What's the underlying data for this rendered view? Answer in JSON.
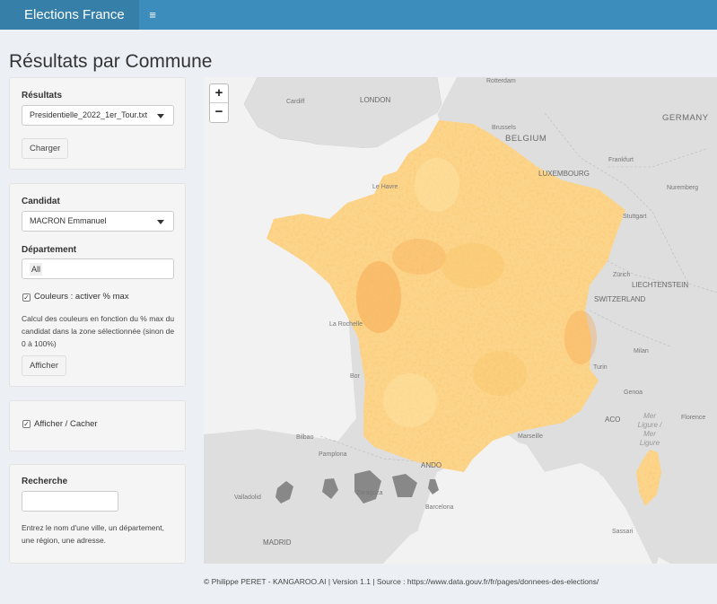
{
  "header": {
    "brand": "Elections France",
    "menu_icon": "hamburger-icon",
    "menu_glyph": "≡"
  },
  "page": {
    "title": "Résultats par Commune"
  },
  "results_panel": {
    "label": "Résultats",
    "file_select": "Presidentielle_2022_1er_Tour.txt",
    "load_button": "Charger"
  },
  "candidate_panel": {
    "candidate_label": "Candidat",
    "candidate_select": "MACRON Emmanuel",
    "department_label": "Département",
    "department_value": "All",
    "colors_checkbox_label": "Couleurs : activer % max",
    "colors_checked": true,
    "help_text": "Calcul des couleurs en fonction du % max du candidat dans la zone sélectionnée (sinon de 0 à 100%)",
    "show_button": "Afficher"
  },
  "toggle_panel": {
    "checkbox_label": "Afficher / Cacher",
    "checked": true
  },
  "search_panel": {
    "label": "Recherche",
    "input_value": "",
    "help_text": "Entrez le nom d'une ville, un département, une région, une adresse."
  },
  "map": {
    "zoom_in": "+",
    "zoom_out": "−",
    "labels": {
      "london": "LONDON",
      "cardiff": "Cardiff",
      "rotterdam": "Rotterdam",
      "brussels": "Brussels",
      "belgium": "BELGIUM",
      "germany": "GERMANY",
      "luxembourg": "LUXEMBOURG",
      "frankfurt": "Frankfurt",
      "le_havre": "Le Havre",
      "nuremberg": "Nuremberg",
      "stuttgart": "Stuttgart",
      "zurich": "Zürich",
      "liechtenstein": "LIECHTENSTEIN",
      "switzerland": "SWITZERLAND",
      "la_rochelle": "La Rochelle",
      "milan": "Milan",
      "turin": "Turin",
      "genoa": "Genoa",
      "bordeaux": "Bor",
      "monaco": "ACO",
      "mer_ligure": "Mer Ligure / Mer Ligure",
      "florence": "Florence",
      "bilbao": "Bilbao",
      "marseille": "Marseille",
      "andorra": "ANDO",
      "pamplona": "Pamplona",
      "valladolid": "Valladolid",
      "zaragoza": "Zaragoza",
      "barcelona": "Barcelona",
      "madrid": "MADRID",
      "sassari": "Sassari"
    },
    "colors": {
      "sea": "#f2f2f2",
      "land": "#dedede",
      "result_light": "#fde3a4",
      "result_mid": "#fbc56a",
      "result_dark": "#f0903a"
    }
  },
  "footer": {
    "text": "© Philippe PERET - KANGAROO.AI | Version 1.1 | Source : https://www.data.gouv.fr/fr/pages/donnees-des-elections/"
  }
}
